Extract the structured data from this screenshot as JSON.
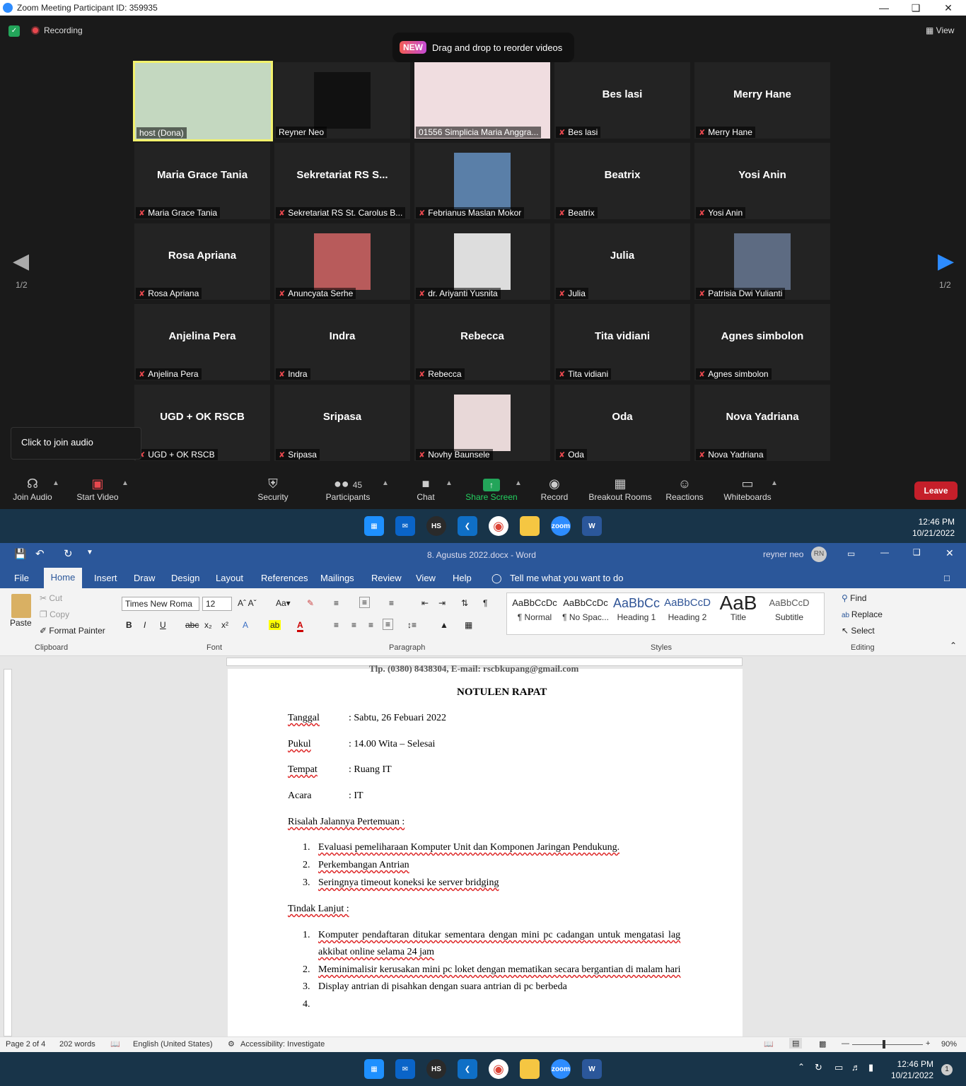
{
  "zoom": {
    "title": "Zoom Meeting Participant ID: 359935",
    "recording": "Recording",
    "view": "View",
    "banner_badge": "NEW",
    "banner_text": "Drag and drop to reorder videos",
    "page_indicator": "1/2",
    "tooltip": "Click to join audio",
    "tiles": [
      {
        "name": "",
        "label": "host (Dona)",
        "photo": true,
        "host": true
      },
      {
        "name": "",
        "label": "Reyner Neo",
        "photo": true
      },
      {
        "name": "",
        "label": "01556 Simplicia Maria Anggra...",
        "photo": true
      },
      {
        "name": "Bes lasi",
        "label": "Bes lasi"
      },
      {
        "name": "Merry Hane",
        "label": "Merry Hane"
      },
      {
        "name": "Maria Grace Tania",
        "label": "Maria Grace Tania"
      },
      {
        "name": "Sekretariat  RS  S...",
        "label": "Sekretariat RS St. Carolus B..."
      },
      {
        "name": "",
        "label": "Febrianus Maslan Mokor",
        "photo": true
      },
      {
        "name": "Beatrix",
        "label": "Beatrix"
      },
      {
        "name": "Yosi Anin",
        "label": "Yosi Anin"
      },
      {
        "name": "Rosa Apriana",
        "label": "Rosa Apriana"
      },
      {
        "name": "",
        "label": "Anuncyata Serhe",
        "photo": true
      },
      {
        "name": "",
        "label": "dr. Ariyanti Yusnita",
        "photo": true
      },
      {
        "name": "Julia",
        "label": "Julia"
      },
      {
        "name": "",
        "label": "Patrisia Dwi Yulianti",
        "photo": true
      },
      {
        "name": "Anjelina Pera",
        "label": "Anjelina Pera"
      },
      {
        "name": "Indra",
        "label": "Indra"
      },
      {
        "name": "Rebecca",
        "label": "Rebecca"
      },
      {
        "name": "Tita vidiani",
        "label": "Tita vidiani"
      },
      {
        "name": "Agnes simbolon",
        "label": "Agnes simbolon"
      },
      {
        "name": "UGD + OK RSCB",
        "label": "UGD + OK RSCB"
      },
      {
        "name": "Sripasa",
        "label": "Sripasa"
      },
      {
        "name": "",
        "label": "Novhy Baunsele",
        "photo": true
      },
      {
        "name": "Oda",
        "label": "Oda"
      },
      {
        "name": "Nova Yadriana",
        "label": "Nova Yadriana"
      }
    ],
    "toolbar": {
      "join_audio": "Join Audio",
      "start_video": "Start Video",
      "security": "Security",
      "participants": "Participants",
      "participants_count": "45",
      "chat": "Chat",
      "share_screen": "Share Screen",
      "record": "Record",
      "breakout": "Breakout Rooms",
      "reactions": "Reactions",
      "whiteboards": "Whiteboards",
      "leave": "Leave"
    }
  },
  "taskbar": {
    "time": "12:46 PM",
    "date": "10/21/2022",
    "hs": "HS",
    "zoom": "zoom",
    "notif": "1"
  },
  "word": {
    "doc_title": "8. Agustus 2022.docx  -  Word",
    "user": "reyner neo",
    "initials": "RN",
    "tabs": [
      "File",
      "Home",
      "Insert",
      "Draw",
      "Design",
      "Layout",
      "References",
      "Mailings",
      "Review",
      "View",
      "Help"
    ],
    "tell_me": "Tell me what you want to do",
    "clipboard": {
      "paste": "Paste",
      "cut": "Cut",
      "copy": "Copy",
      "format_painter": "Format Painter",
      "group": "Clipboard"
    },
    "font": {
      "name": "Times New Roma",
      "size": "12",
      "group": "Font"
    },
    "paragraph_group": "Paragraph",
    "styles": [
      {
        "preview": "AaBbCcDc",
        "name": "¶ Normal"
      },
      {
        "preview": "AaBbCcDc",
        "name": "¶ No Spac..."
      },
      {
        "preview": "AaBbCc",
        "name": "Heading 1"
      },
      {
        "preview": "AaBbCcD",
        "name": "Heading 2"
      },
      {
        "preview": "AaB",
        "name": "Title"
      },
      {
        "preview": "AaBbCcD",
        "name": "Subtitle"
      }
    ],
    "styles_group": "Styles",
    "editing": {
      "find": "Find",
      "replace": "Replace",
      "select": "Select",
      "group": "Editing"
    },
    "doc": {
      "top_cut": "Tlp. (0380) 8438304, E-mail: rscbkupang@gmail.com",
      "heading": "NOTULEN RAPAT",
      "fields": [
        {
          "label": "Tanggal",
          "value": ": Sabtu,  26  Febuari 2022"
        },
        {
          "label": "Pukul",
          "value": ": 14.00 Wita – Selesai"
        },
        {
          "label": "Tempat",
          "value": ": Ruang IT"
        },
        {
          "label": "Acara",
          "value": ": IT"
        }
      ],
      "risalah": "Risalah Jalannya Pertemuan :",
      "risalah_items": [
        "Evaluasi pemeliharaan Komputer Unit dan Komponen Jaringan Pendukung.",
        "Perkembangan Antrian",
        "Seringnya timeout koneksi ke server bridging"
      ],
      "tindak": "Tindak Lanjut :",
      "tindak_items": [
        "Komputer pendaftaran ditukar sementara dengan mini pc cadangan untuk mengatasi lag",
        "akkibat online selama 24 jam",
        "Meminimalisir kerusakan mini pc loket dengan mematikan secara bergantian di malam hari",
        "Display antrian di pisahkan dengan suara antrian di pc berbeda",
        ""
      ],
      "nums": [
        "1.",
        "2.",
        "3.",
        "4."
      ]
    },
    "status": {
      "page": "Page 2 of 4",
      "words": "202 words",
      "lang": "English (United States)",
      "access": "Accessibility: Investigate",
      "zoom": "90%"
    }
  }
}
